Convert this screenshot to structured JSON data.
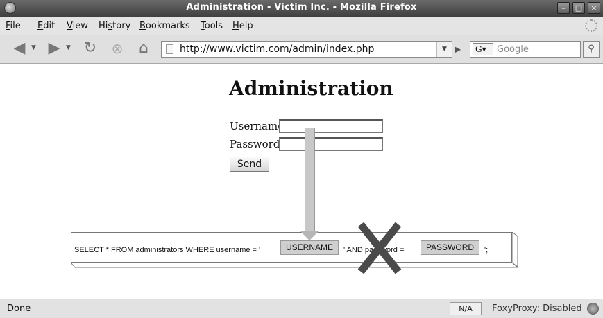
{
  "window": {
    "title": "Administration - Victim Inc. - Mozilla Firefox"
  },
  "menu": {
    "items": [
      {
        "key": "F",
        "rest": "ile"
      },
      {
        "key": "E",
        "rest": "dit"
      },
      {
        "key": "V",
        "rest": "iew"
      },
      {
        "prefix": "Hi",
        "key": "s",
        "rest": "tory"
      },
      {
        "key": "B",
        "rest": "ookmarks"
      },
      {
        "key": "T",
        "rest": "ools"
      },
      {
        "key": "H",
        "rest": "elp"
      }
    ]
  },
  "toolbar": {
    "url": "http://www.victim.com/admin/index.php",
    "search_engine": "G",
    "search_placeholder": "Google"
  },
  "page": {
    "heading": "Administration",
    "username_label": "Username",
    "password_label": "Password",
    "send_label": "Send",
    "username_value": "",
    "password_value": ""
  },
  "sql": {
    "part1": "SELECT * FROM administrators WHERE username = '",
    "token1": "USERNAME",
    "part2": "' AND password = '",
    "token2": "PASSWORD",
    "part3": "';"
  },
  "statusbar": {
    "status": "Done",
    "na": "N/A",
    "foxyproxy": "FoxyProxy: Disabled"
  },
  "icons": {
    "back": "back-arrow-icon",
    "forward": "forward-arrow-icon",
    "reload": "reload-icon",
    "stop": "stop-icon",
    "home": "home-icon",
    "search": "magnifier-icon"
  }
}
